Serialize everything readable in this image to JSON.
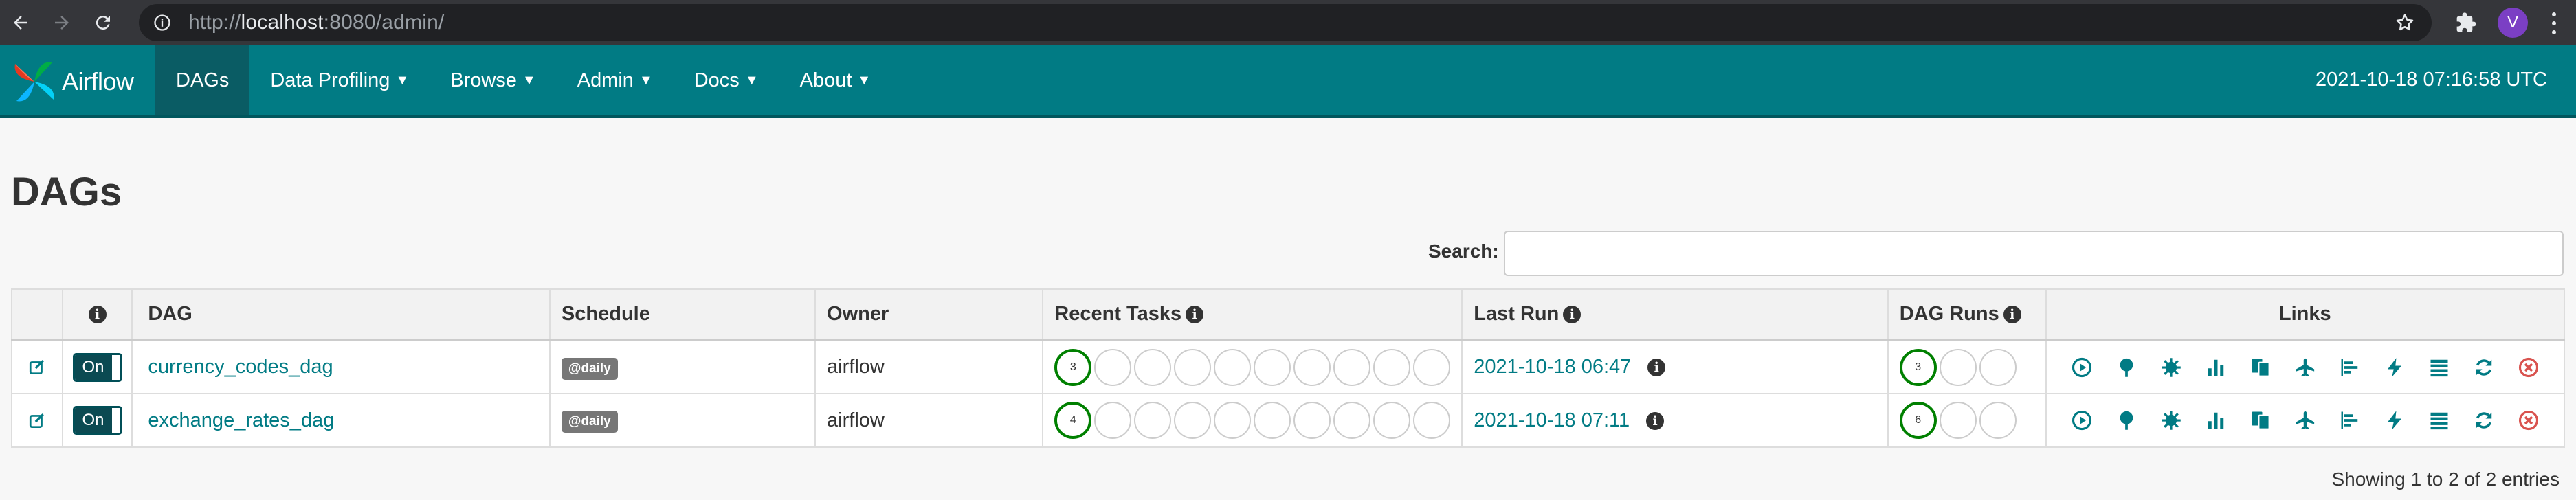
{
  "browser": {
    "url_prefix": "http://",
    "url_host": "localhost",
    "url_rest": ":8080/admin/",
    "profile_initial": "V"
  },
  "navbar": {
    "brand": "Airflow",
    "items": [
      {
        "label": "DAGs",
        "active": true,
        "dropdown": false
      },
      {
        "label": "Data Profiling",
        "dropdown": true
      },
      {
        "label": "Browse",
        "dropdown": true
      },
      {
        "label": "Admin",
        "dropdown": true
      },
      {
        "label": "Docs",
        "dropdown": true
      },
      {
        "label": "About",
        "dropdown": true
      }
    ],
    "clock": "2021-10-18 07:16:58 UTC"
  },
  "page": {
    "title": "DAGs",
    "search_label": "Search:",
    "search_value": ""
  },
  "table": {
    "headers": {
      "dag": "DAG",
      "schedule": "Schedule",
      "owner": "Owner",
      "recent_tasks": "Recent Tasks",
      "last_run": "Last Run",
      "dag_runs": "DAG Runs",
      "links": "Links"
    },
    "rows": [
      {
        "toggle": "On",
        "dag": "currency_codes_dag",
        "schedule": "@daily",
        "owner": "airflow",
        "recent_success": "3",
        "last_run": "2021-10-18 06:47",
        "dag_runs_success": "3"
      },
      {
        "toggle": "On",
        "dag": "exchange_rates_dag",
        "schedule": "@daily",
        "owner": "airflow",
        "recent_success": "4",
        "last_run": "2021-10-18 07:11",
        "dag_runs_success": "6"
      }
    ]
  },
  "footer": {
    "info": "Showing 1 to 2 of 2 entries"
  },
  "colors": {
    "navbar": "#017b84",
    "accent": "#017b84",
    "success": "#008000",
    "delete": "#d9534f"
  },
  "icons": {
    "links": [
      "trigger-dag-icon",
      "tree-view-icon",
      "graph-view-icon",
      "task-duration-icon",
      "task-tries-icon",
      "landing-times-icon",
      "gantt-icon",
      "code-view-icon",
      "logs-icon",
      "refresh-icon",
      "delete-dag-icon"
    ]
  }
}
